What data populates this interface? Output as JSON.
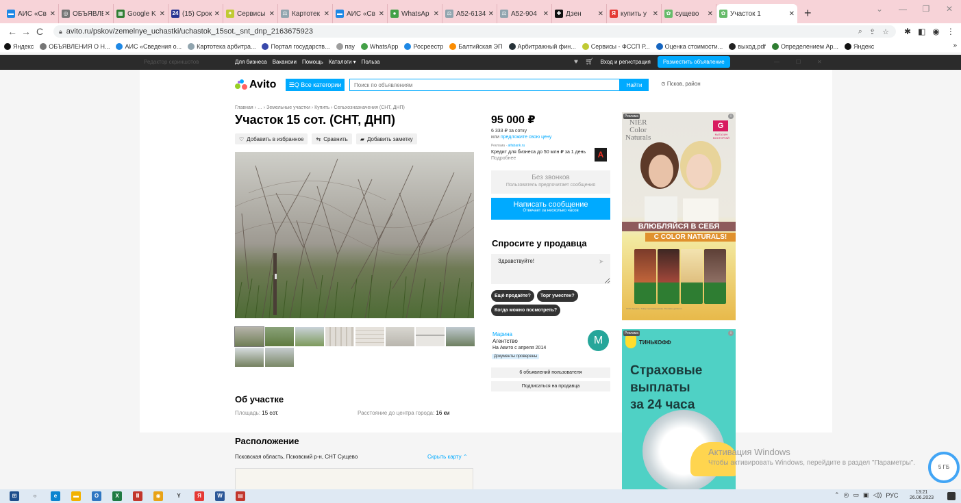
{
  "browser": {
    "tabs": [
      {
        "label": "АИС «Св",
        "color": "#1e88e5",
        "glyph": "▬"
      },
      {
        "label": "ОБЪЯВЛЕ",
        "color": "#757575",
        "glyph": "◎"
      },
      {
        "label": "Google K",
        "color": "#2e7d32",
        "glyph": "▦"
      },
      {
        "label": "(15) Срок",
        "color": "#283593",
        "glyph": "24"
      },
      {
        "label": "Сервисы",
        "color": "#c0ca33",
        "glyph": "✦"
      },
      {
        "label": "Картотек",
        "color": "#90a4ae",
        "glyph": "⚖"
      },
      {
        "label": "АИС «Св",
        "color": "#1e88e5",
        "glyph": "▬"
      },
      {
        "label": "WhatsAp",
        "color": "#43a047",
        "glyph": "●"
      },
      {
        "label": "A52-6134",
        "color": "#90a4ae",
        "glyph": "⚖"
      },
      {
        "label": "A52-904",
        "color": "#90a4ae",
        "glyph": "⚖"
      },
      {
        "label": "Дзен",
        "color": "#111111",
        "glyph": "✚"
      },
      {
        "label": "купить у",
        "color": "#e53935",
        "glyph": "Я"
      },
      {
        "label": "сущево",
        "color": "#66bb6a",
        "glyph": "✿"
      }
    ],
    "active_tab": {
      "label": "Участок 1",
      "color": "#66bb6a",
      "glyph": "✿"
    },
    "new_tab": "+",
    "url": "avito.ru/pskov/zemelnye_uchastki/uchastok_15sot._snt_dnp_2163675923",
    "bookmarks": [
      {
        "label": "Яндекс",
        "color": "#111111"
      },
      {
        "label": "ОБЪЯВЛЕНИЯ О Н...",
        "color": "#757575"
      },
      {
        "label": "АИС «Сведения о...",
        "color": "#1e88e5"
      },
      {
        "label": "Картотека арбитра...",
        "color": "#90a4ae"
      },
      {
        "label": "Портал государств...",
        "color": "#3949ab"
      },
      {
        "label": "пay",
        "color": "#9e9e9e"
      },
      {
        "label": "WhatsApp",
        "color": "#43a047"
      },
      {
        "label": "Росреестр",
        "color": "#1e88e5"
      },
      {
        "label": "Балтийская ЭП",
        "color": "#fb8c00"
      },
      {
        "label": "Арбитражный фин...",
        "color": "#263238"
      },
      {
        "label": "Сервисы - ФССП Р...",
        "color": "#c0ca33"
      },
      {
        "label": "Оценка стоимости...",
        "color": "#1565c0"
      },
      {
        "label": "выход.pdf",
        "color": "#212121"
      },
      {
        "label": "Определением Ар...",
        "color": "#2e7d32"
      },
      {
        "label": "Яндекс",
        "color": "#111111"
      }
    ],
    "bookmarks_more": "»"
  },
  "topnav": {
    "ghost_editor": "Редактор скриншотов",
    "links": [
      "Для бизнеса",
      "Вакансии",
      "Помощь",
      "Каталоги ▾",
      "Польза"
    ],
    "login": "Вход и регистрация",
    "post_ad": "Разместить объявление"
  },
  "header": {
    "logo": "Avito",
    "categories": "☰Q Все категории",
    "search_placeholder": "Поиск по объявлениям",
    "find": "Найти",
    "location": "⊙ Псков, район"
  },
  "listing": {
    "breadcrumb": "Главная › … › Земельные участки › Купить › Сельхозназначения (СНТ, ДНП)",
    "title": "Участок 15 сот. (СНТ, ДНП)",
    "actions": {
      "favorite": "Добавить в избранное",
      "compare": "Сравнить",
      "note": "Добавить заметку"
    },
    "about_title": "Об участке",
    "area_label": "Площадь:",
    "area_value": "15 сот.",
    "distance_label": "Расстояние до центра города:",
    "distance_value": "16 км",
    "location_title": "Расположение",
    "address": "Псковская область, Псковский р-н, СНТ Сущево",
    "hide_map": "Скрыть карту ⌃"
  },
  "sidebar": {
    "price": "95 000 ₽",
    "per_sotka": "6 333 ₽ за сотку",
    "offer_prefix": "или ",
    "offer_link": "предложите свою цену",
    "ad_prefix": "Реклама · ",
    "ad_link": "alfabank.ru",
    "credit_text": "Кредит для бизнеса до 50 млн ₽ за 1 день ",
    "credit_more": "Подробнее",
    "alfa_glyph": "А",
    "no_calls_title": "Без звонков",
    "no_calls_sub": "Пользователь предпочитает сообщения",
    "write_title": "Написать сообщение",
    "write_sub": "Отвечает за несколько часов",
    "ask_title": "Спросите у продавца",
    "ask_value": "Здравствуйте!",
    "chips": [
      "Ещё продаёте?",
      "Торг уместен?",
      "Когда можно посмотреть?"
    ],
    "seller_name": "Марина",
    "seller_type": "Агентство",
    "seller_since": "На Авито с апреля 2014",
    "docs": "Документы проверены",
    "avatar": "М",
    "user_ads": "6 объявлений пользователя",
    "subscribe": "Подписаться на продавца"
  },
  "ads": {
    "label": "Реклама",
    "cn_logo_1": "NIER",
    "cn_logo_2": "Color",
    "cn_logo_3": "Naturals",
    "gar_glyph": "G",
    "gar_sub": "МАГАЗИН ВОСТОРГАЙ",
    "slogan_1": "ВЛЮБЛЯЙСЯ В СЕБЯ",
    "slogan_2": "С COLOR NATURALS!",
    "fine_print": "ООО Лореаль. Товар сертифицирован. Реклама. garnier.ru",
    "tinkoff": "ТИНЬКОФФ",
    "tinkoff_headline_1": "Страховые",
    "tinkoff_headline_2": "выплаты",
    "tinkoff_headline_3": "за 24 часа"
  },
  "windows": {
    "activate": "Активация Windows",
    "activate_sub": "Чтобы активировать Windows, перейдите в раздел \"Параметры\".",
    "badge": "5 ГБ",
    "tray_lang": "РУС",
    "time": "13:21",
    "date": "26.06.2023"
  }
}
